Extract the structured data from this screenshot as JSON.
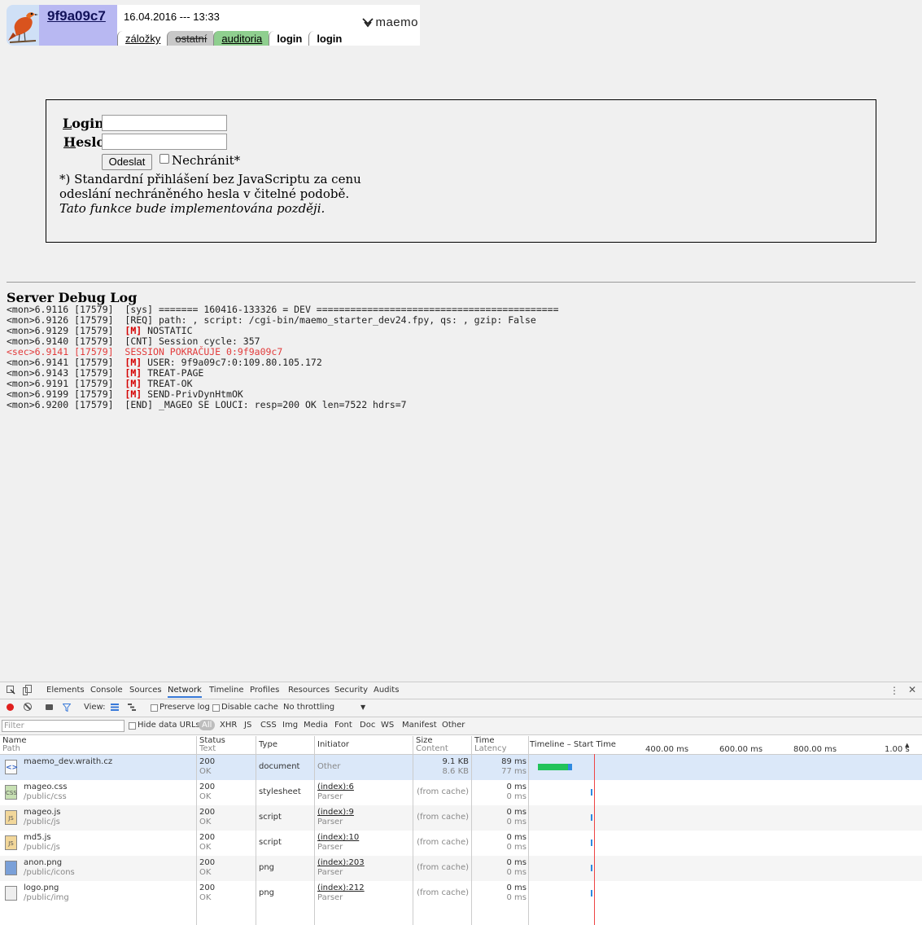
{
  "header": {
    "user_id": "9f9a09c7",
    "datetime": "16.04.2016 --- 13:33",
    "logo_text": "maemo",
    "tabs": [
      "záložky",
      "ostatní",
      "auditoria",
      "login",
      "login"
    ]
  },
  "login_form": {
    "login_label_first": "L",
    "login_label_rest": "ogin:",
    "password_label_first": "H",
    "password_label_rest": "eslo:",
    "login_value": "",
    "password_value": "",
    "submit_label": "Odeslat",
    "unprotected_label": "Nechránit*",
    "note_line1": "*) Standardní přihlášení bez JavaScriptu za cenu",
    "note_line2": "odeslání nechráněného hesla v čitelné podobě.",
    "note_line3": "Tato funkce bude implementována později."
  },
  "debug": {
    "title": "Server Debug Log",
    "lines": [
      {
        "prefix": "<mon>6.9116 [17579]  ",
        "tag": "",
        "text": "[sys] ======= 160416-133326 = DEV ===========================================",
        "red": false
      },
      {
        "prefix": "<mon>6.9126 [17579]  ",
        "tag": "",
        "text": "[REQ] path: , script: /cgi-bin/maemo_starter_dev24.fpy, qs: , gzip: False",
        "red": false
      },
      {
        "prefix": "<mon>6.9129 [17579]  ",
        "tag": "[M]",
        "text": " NOSTATIC",
        "red": false
      },
      {
        "prefix": "<mon>6.9140 [17579]  ",
        "tag": "",
        "text": "[CNT] Session cycle: 357",
        "red": false
      },
      {
        "prefix": "<sec>6.9141 [17579]  ",
        "tag": "",
        "text": "SESSION POKRAČUJE 0:9f9a09c7",
        "red": true
      },
      {
        "prefix": "<mon>6.9141 [17579]  ",
        "tag": "[M]",
        "text": " USER: 9f9a09c7:0:109.80.105.172",
        "red": false
      },
      {
        "prefix": "<mon>6.9143 [17579]  ",
        "tag": "[M]",
        "text": " TREAT-PAGE",
        "red": false
      },
      {
        "prefix": "<mon>6.9191 [17579]  ",
        "tag": "[M]",
        "text": " TREAT-OK",
        "red": false
      },
      {
        "prefix": "<mon>6.9199 [17579]  ",
        "tag": "[M]",
        "text": " SEND-PrivDynHtmOK",
        "red": false
      },
      {
        "prefix": "<mon>6.9200 [17579]  ",
        "tag": "",
        "text": "[END] _MAGEO SE LOUCI: resp=200 OK len=7522 hdrs=7",
        "red": false
      }
    ]
  },
  "devtools": {
    "tabs": [
      "Elements",
      "Console",
      "Sources",
      "Network",
      "Timeline",
      "Profiles",
      "Resources",
      "Security",
      "Audits"
    ],
    "active_tab": "Network",
    "toolbar": {
      "view_label": "View:",
      "preserve_log": "Preserve log",
      "disable_cache": "Disable cache",
      "throttling": "No throttling"
    },
    "filter": {
      "placeholder": "Filter",
      "hide_data_urls": "Hide data URLs",
      "types": [
        "All",
        "XHR",
        "JS",
        "CSS",
        "Img",
        "Media",
        "Font",
        "Doc",
        "WS",
        "Manifest",
        "Other"
      ]
    },
    "columns": {
      "name": "Name",
      "name_sub": "Path",
      "status": "Status",
      "status_sub": "Text",
      "type": "Type",
      "initiator": "Initiator",
      "size": "Size",
      "size_sub": "Content",
      "time": "Time",
      "time_sub": "Latency",
      "timeline": "Timeline – Start Time",
      "ticks": [
        "400.00 ms",
        "600.00 ms",
        "800.00 ms",
        "1.00 s"
      ]
    },
    "requests": [
      {
        "name": "maemo_dev.wraith.cz",
        "path": "",
        "status": "200",
        "status_text": "OK",
        "type": "document",
        "initiator": "Other",
        "initiator_sub": "",
        "size": "9.1 KB",
        "content": "8.6 KB",
        "time": "89 ms",
        "latency": "77 ms",
        "icon": "doc",
        "glyph": "<>"
      },
      {
        "name": "mageo.css",
        "path": "/public/css",
        "status": "200",
        "status_text": "OK",
        "type": "stylesheet",
        "initiator": "(index):6",
        "initiator_sub": "Parser",
        "size": "(from cache)",
        "content": "",
        "time": "0 ms",
        "latency": "0 ms",
        "icon": "css",
        "glyph": "CSS"
      },
      {
        "name": "mageo.js",
        "path": "/public/js",
        "status": "200",
        "status_text": "OK",
        "type": "script",
        "initiator": "(index):9",
        "initiator_sub": "Parser",
        "size": "(from cache)",
        "content": "",
        "time": "0 ms",
        "latency": "0 ms",
        "icon": "js",
        "glyph": "JS"
      },
      {
        "name": "md5.js",
        "path": "/public/js",
        "status": "200",
        "status_text": "OK",
        "type": "script",
        "initiator": "(index):10",
        "initiator_sub": "Parser",
        "size": "(from cache)",
        "content": "",
        "time": "0 ms",
        "latency": "0 ms",
        "icon": "js",
        "glyph": "JS"
      },
      {
        "name": "anon.png",
        "path": "/public/icons",
        "status": "200",
        "status_text": "OK",
        "type": "png",
        "initiator": "(index):203",
        "initiator_sub": "Parser",
        "size": "(from cache)",
        "content": "",
        "time": "0 ms",
        "latency": "0 ms",
        "icon": "png",
        "glyph": ""
      },
      {
        "name": "logo.png",
        "path": "/public/img",
        "status": "200",
        "status_text": "OK",
        "type": "png",
        "initiator": "(index):212",
        "initiator_sub": "Parser",
        "size": "(from cache)",
        "content": "",
        "time": "0 ms",
        "latency": "0 ms",
        "icon": "logo",
        "glyph": ""
      }
    ],
    "colors": {
      "green": "#22c35a",
      "blue": "#2f8ae0",
      "marker": "#ee4444"
    }
  }
}
